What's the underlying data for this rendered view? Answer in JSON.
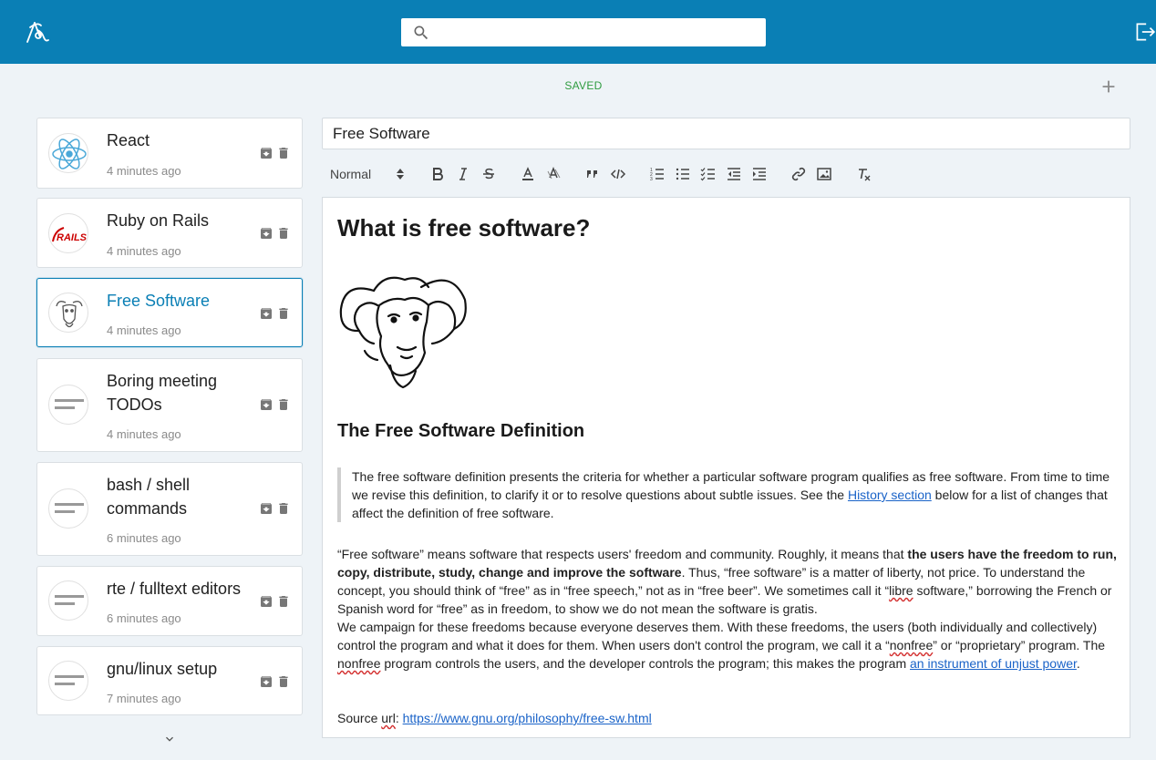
{
  "header": {
    "search_placeholder": "",
    "search_value": ""
  },
  "status": {
    "saved_label": "SAVED"
  },
  "notes": [
    {
      "title": "React",
      "time": "4 minutes ago",
      "avatar": "react-logo"
    },
    {
      "title": "Ruby on Rails",
      "time": "4 minutes ago",
      "avatar": "rails-logo",
      "logo_text": "RAILS"
    },
    {
      "title": "Free Software",
      "time": "4 minutes ago",
      "avatar": "gnu-logo",
      "active": true
    },
    {
      "title": "Boring meeting TODOs",
      "time": "4 minutes ago",
      "avatar": "text-icon"
    },
    {
      "title": "bash / shell commands",
      "time": "6 minutes ago",
      "avatar": "text-icon"
    },
    {
      "title": "rte / fulltext editors",
      "time": "6 minutes ago",
      "avatar": "text-icon"
    },
    {
      "title": "gnu/linux setup",
      "time": "7 minutes ago",
      "avatar": "text-icon"
    }
  ],
  "editor": {
    "title_value": "Free Software",
    "format_select": "Normal",
    "heading1": "What is free software?",
    "heading2": "The Free Software Definition",
    "quote_part1": "The free software definition presents the criteria for whether a particular software program qualifies as free software. From time to time we revise this definition, to clarify it or to resolve questions about subtle issues. See the ",
    "quote_link": "History section",
    "quote_part2": " below for a list of changes that affect the definition of free software.",
    "p1_part1": "“Free software” means software that respects users' freedom and community. Roughly, it means that ",
    "p1_bold": "the users have the freedom to run, copy, distribute, study, change and improve the software",
    "p1_part2": ". Thus, “free software” is a matter of liberty, not price. To understand the concept, you should think of “free” as in “free speech,” not as in “free beer”. We sometimes call it “",
    "p1_libre": "libre",
    "p1_part3": " software,” borrowing the French or Spanish word for “free” as in freedom, to show we do not mean the software is gratis.",
    "p2_part1": "We campaign for these freedoms because everyone deserves them. With these freedoms, the users (both individually and collectively) control the program and what it does for them. When users don't control the program, we call it a “",
    "p2_nonfree1": "nonfree",
    "p2_part2": "” or “proprietary” program. The ",
    "p2_nonfree2": "nonfree",
    "p2_part3": " program controls the users, and the developer controls the program; this makes the program ",
    "p2_link": " an instrument of unjust power",
    "p2_part4": ".",
    "source_label": "Source ",
    "source_url_word": "url",
    "source_colon": ": ",
    "source_link": "https://www.gnu.org/philosophy/free-sw.html"
  },
  "colors": {
    "topbar": "#0a7fb5",
    "accent": "#0a7fb5",
    "saved": "#2e9b3f",
    "link": "#1a63c8"
  }
}
